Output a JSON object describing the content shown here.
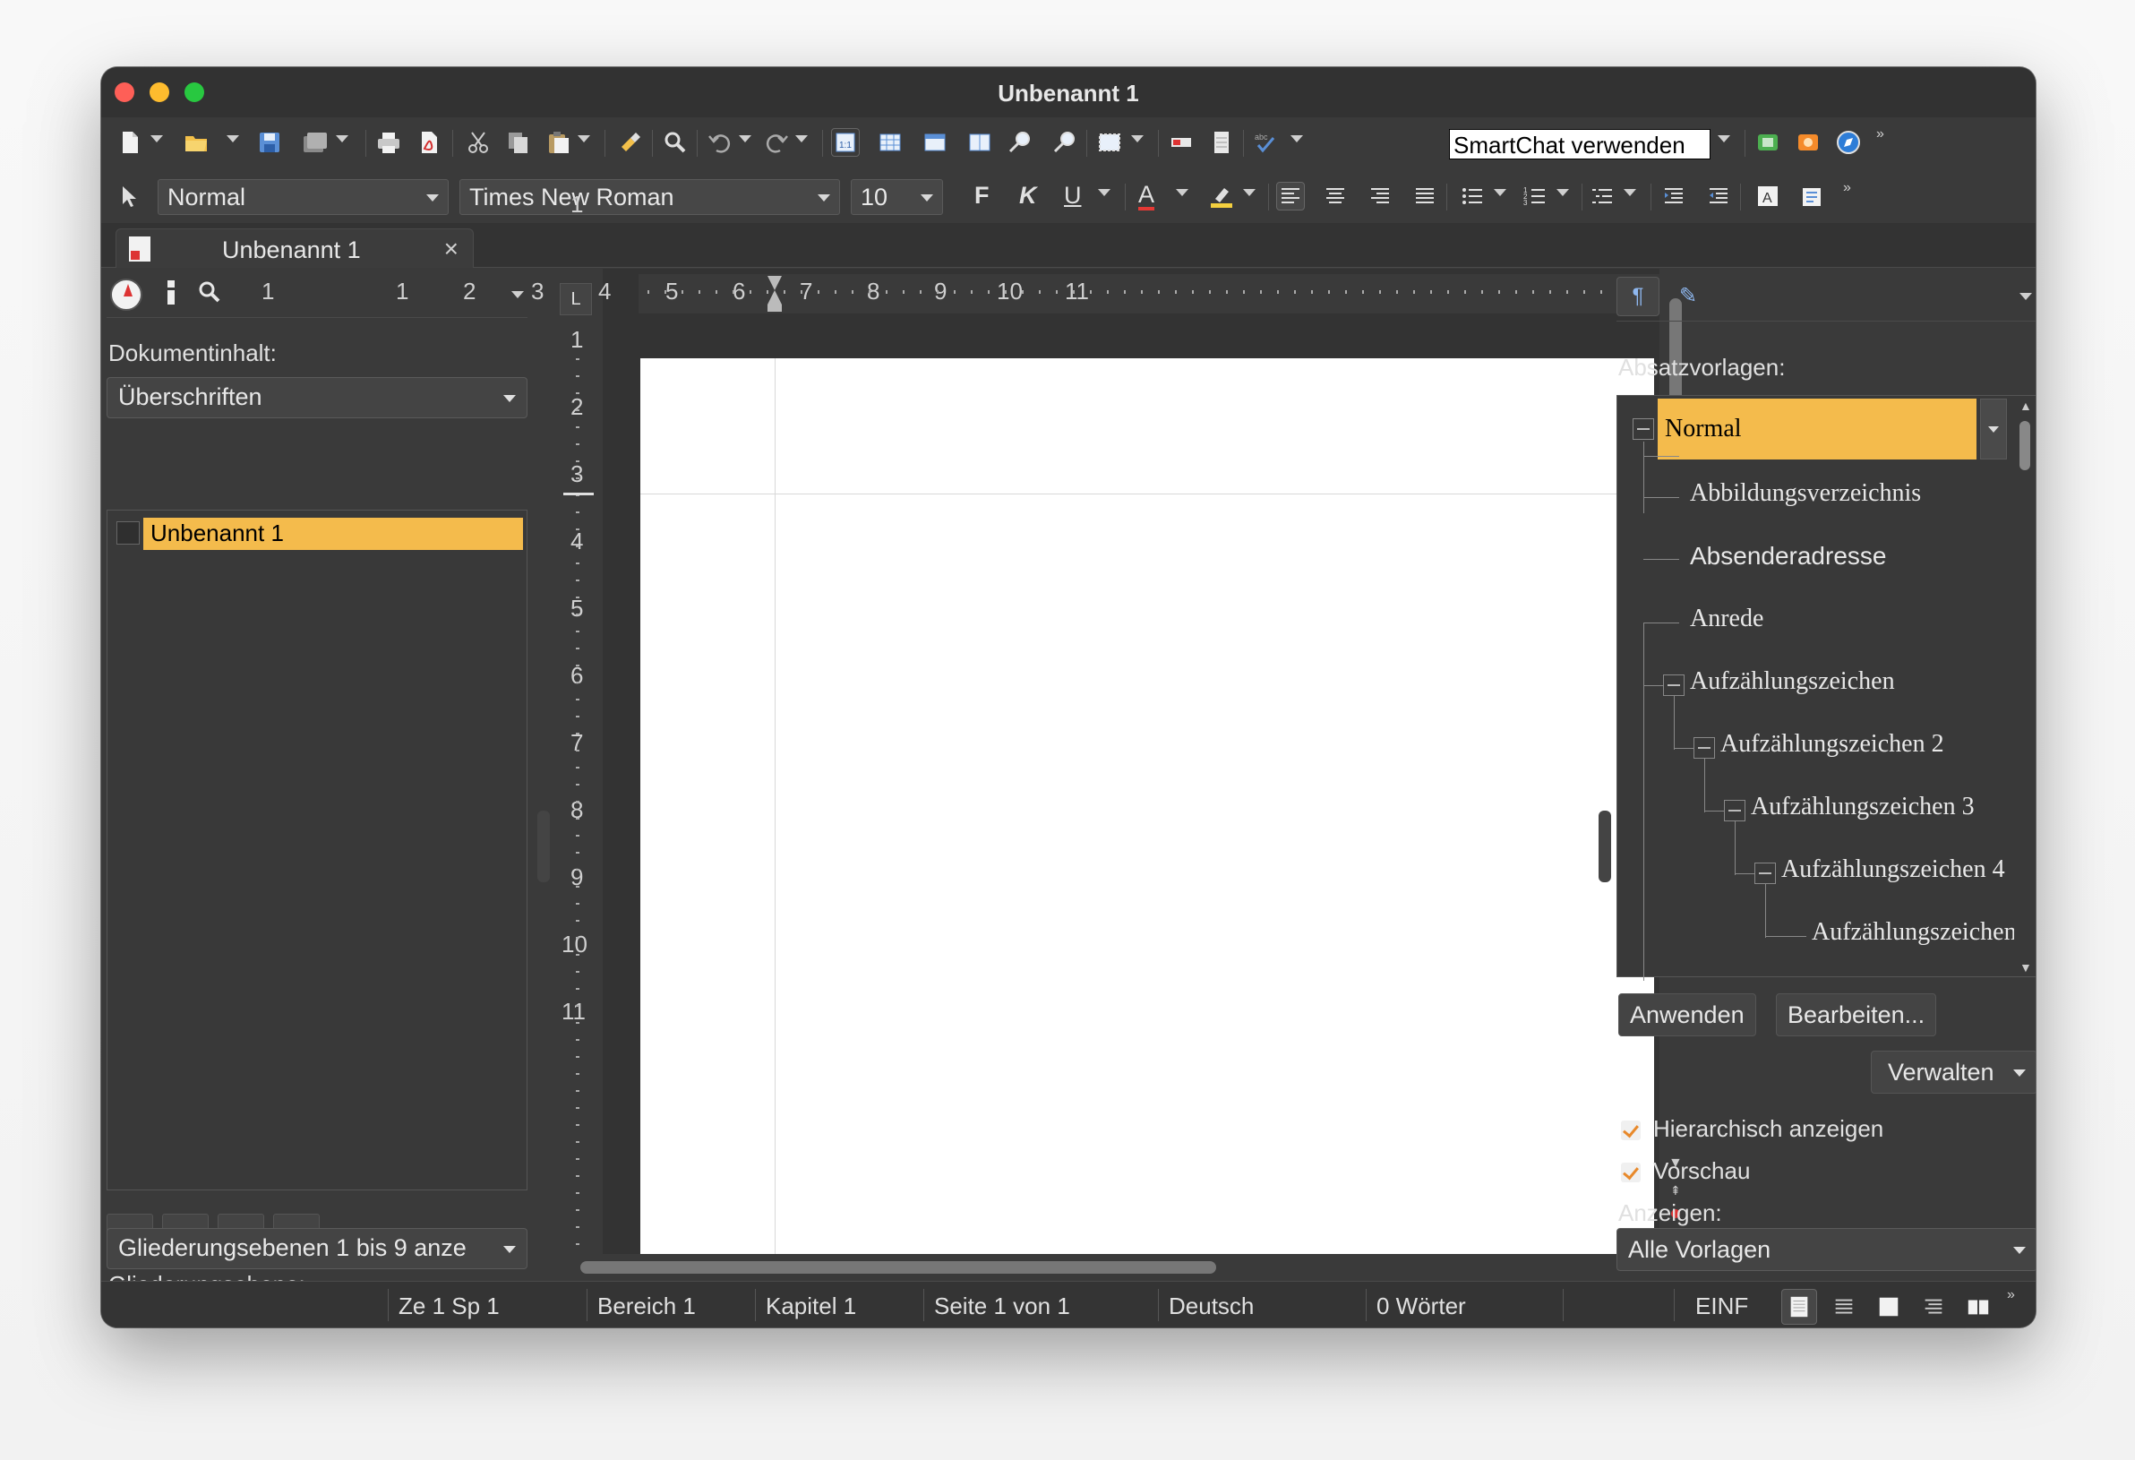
{
  "window": {
    "title": "Unbenannt 1"
  },
  "toolbar": {
    "smartchat_value": "SmartChat verwenden",
    "paragraph_style": "Normal",
    "font_name": "Times New Roman",
    "font_size": "10",
    "bold": "F",
    "italic": "K",
    "underline": "U",
    "font_color": "A"
  },
  "tab": {
    "label": "Unbenannt 1"
  },
  "navigator": {
    "content_label": "Dokumentinhalt:",
    "content_select": "Überschriften",
    "tree_item": "Unbenannt 1",
    "outline_label": "Gliederungsebene:",
    "outline_select": "Gliederungsebenen 1 bis 9 anze"
  },
  "ruler": {
    "h": [
      "1",
      "1",
      "2",
      "3",
      "4",
      "5",
      "6",
      "7",
      "8",
      "9",
      "10",
      "11"
    ],
    "v": [
      "1",
      "1",
      "2",
      "3",
      "4",
      "5",
      "6",
      "7",
      "8",
      "9",
      "10",
      "11"
    ]
  },
  "styles": {
    "label": "Absatzvorlagen:",
    "items": [
      "Normal",
      "Abbildungsverzeichnis",
      "Absenderadresse",
      "Anrede",
      "Aufzählungszeichen",
      "Aufzählungszeichen 2",
      "Aufzählungszeichen 3",
      "Aufzählungszeichen 4",
      "Aufzählungszeichen"
    ],
    "apply": "Anwenden",
    "edit": "Bearbeiten...",
    "manage": "Verwalten",
    "hierarchical": "Hierarchisch anzeigen",
    "preview": "Vorschau",
    "show_label": "Anzeigen:",
    "show_select": "Alle Vorlagen"
  },
  "status": {
    "position": "Ze 1 Sp 1",
    "section": "Bereich 1",
    "chapter": "Kapitel 1",
    "page": "Seite 1 von 1",
    "language": "Deutsch",
    "words": "0 Wörter",
    "mode": "EINF"
  },
  "colors": {
    "highlight": "#f4bb4c",
    "chrome": "#3a3a3a",
    "close": "#fe5f57",
    "minimize": "#febc2e",
    "zoom": "#28c840"
  }
}
